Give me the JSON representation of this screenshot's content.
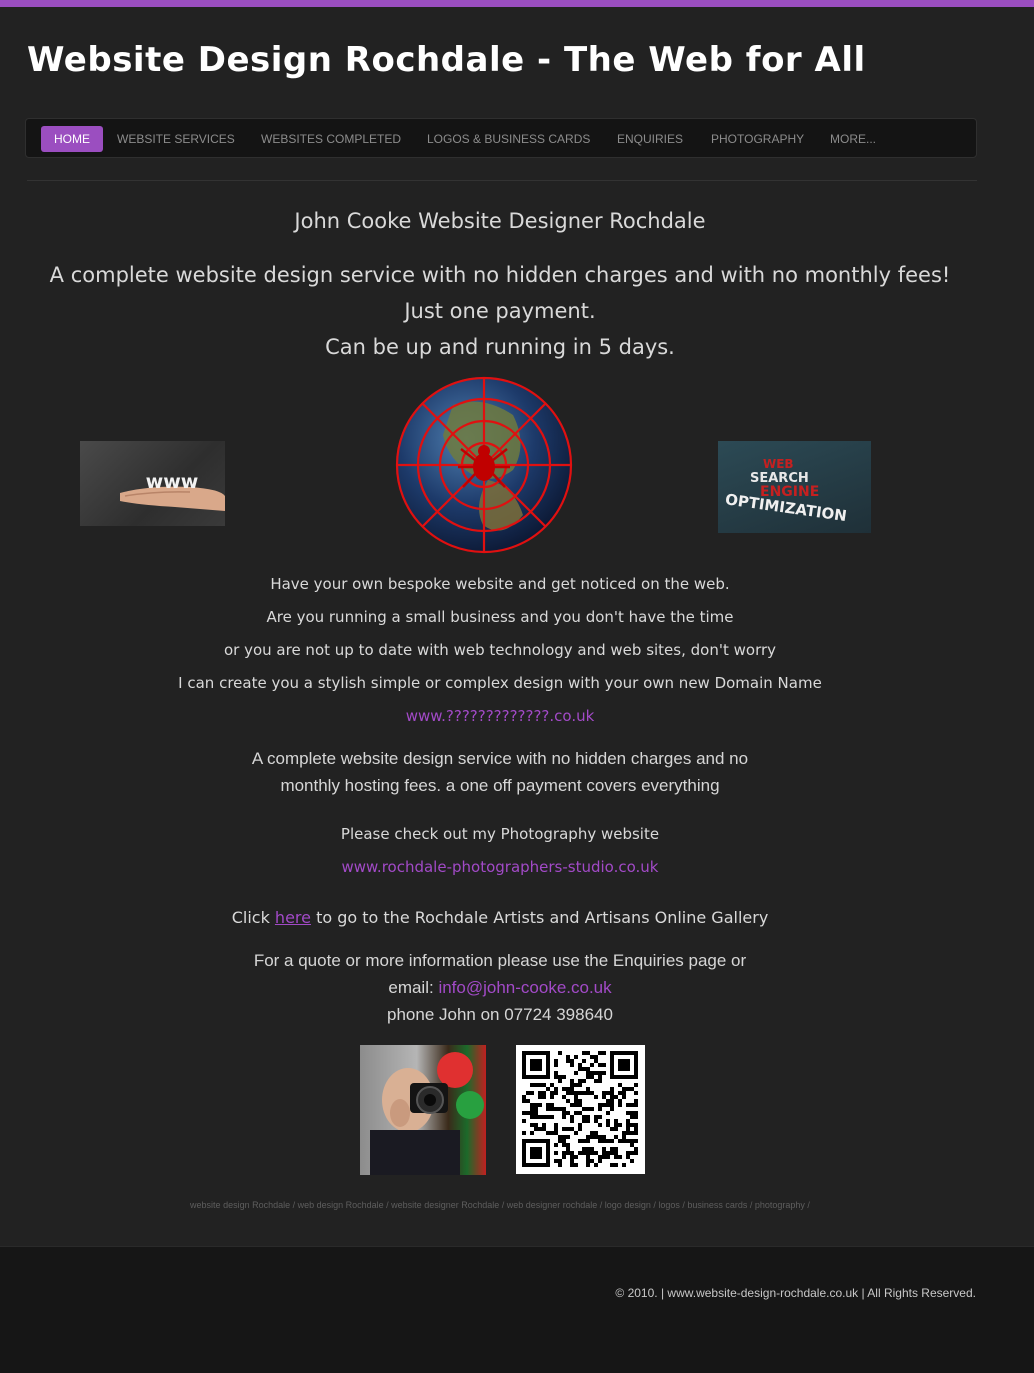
{
  "site": {
    "title": "Website Design Rochdale - The Web for All"
  },
  "nav": {
    "items": [
      {
        "label": "HOME",
        "active": true
      },
      {
        "label": "WEBSITE SERVICES",
        "active": false
      },
      {
        "label": "WEBSITES COMPLETED",
        "active": false
      },
      {
        "label": "LOGOS & BUSINESS CARDS",
        "active": false
      },
      {
        "label": "ENQUIRIES",
        "active": false
      },
      {
        "label": "PHOTOGRAPHY",
        "active": false
      },
      {
        "label": "MORE...",
        "active": false
      }
    ]
  },
  "main": {
    "heading": "John Cooke Website Designer Rochdale",
    "tagline_1": "A complete website design service with no hidden charges and with no monthly fees!",
    "tagline_2": "Just one payment.",
    "tagline_3": "Can be up and running in 5 days.",
    "images": {
      "www_hand_text": "www",
      "seo_word_1": "WEB",
      "seo_word_2": "SEARCH",
      "seo_word_3": "ENGINE",
      "seo_word_4": "OPTIMIZATION"
    },
    "intro_1": "Have your own bespoke website and get noticed on the web.",
    "intro_2": "Are you running a small business and  you don't have the time",
    "intro_3": "or you are not up to date with web technology and web sites, don't worry",
    "intro_4": "I can create you a stylish simple or complex design with your own new Domain Name",
    "domain_link": "www.?????????????.co.uk",
    "service_1": "A complete website design service with no hidden charges and no",
    "service_2": "monthly hosting fees. a one off payment covers everything",
    "photo_prompt": "Please check out my Photography website",
    "photo_link": "www.rochdale-photographers-studio.co.uk",
    "gallery_pre": "Click ",
    "gallery_link": "here",
    "gallery_post": " to go to the Rochdale Artists and Artisans Online Gallery",
    "quote_1": "For a quote or more information please use the Enquiries page or",
    "email_label": "email: ",
    "email": "info@john-cooke.co.uk",
    "phone": "phone John on 07724 398640",
    "keywords": "website design Rochdale / web design Rochdale / website designer Rochdale / web designer rochdale / logo design / logos / business cards / photography /"
  },
  "footer": {
    "copyright": "© 2010. | www.website-design-rochdale.co.uk | All Rights Reserved."
  },
  "colors": {
    "accent": "#9b4ec0",
    "link": "#a24ac7",
    "background": "#222222",
    "footer_bg": "#161616"
  }
}
